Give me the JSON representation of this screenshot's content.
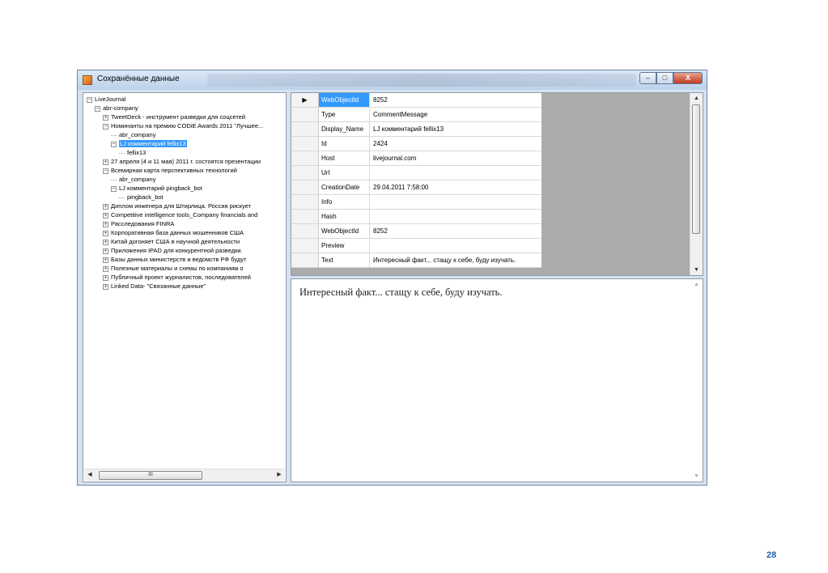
{
  "window": {
    "title": "Сохранённые данные",
    "controls": {
      "minimize": "–",
      "maximize": "□",
      "close": "X"
    }
  },
  "tree": {
    "items": [
      {
        "label": "LiveJournal",
        "level": 0,
        "toggle": "minus"
      },
      {
        "label": "abr-company",
        "level": 1,
        "toggle": "minus"
      },
      {
        "label": "TweetDeck - инструмент разведки для соцсетей",
        "level": 2,
        "toggle": "plus"
      },
      {
        "label": "Номинанты на премию CODiE Awards 2011 \"Лучшее...",
        "level": 2,
        "toggle": "minus"
      },
      {
        "label": "abr_company",
        "level": 3,
        "toggle": "leaf"
      },
      {
        "label": "LJ комментарий fellix13",
        "level": 3,
        "toggle": "minus",
        "selected": true
      },
      {
        "label": "fellix13",
        "level": 4,
        "toggle": "leaf"
      },
      {
        "label": "27 апреля (4 и 11 мая) 2011 г. состоятся презентации",
        "level": 2,
        "toggle": "plus"
      },
      {
        "label": "Всемирная карта перспективных технологий",
        "level": 2,
        "toggle": "minus"
      },
      {
        "label": "abr_company",
        "level": 3,
        "toggle": "leaf"
      },
      {
        "label": "LJ комментарий pingback_bot",
        "level": 3,
        "toggle": "minus"
      },
      {
        "label": "pingback_bot",
        "level": 4,
        "toggle": "leaf"
      },
      {
        "label": "Диплом инженера для Штирлица. Россия рискует",
        "level": 2,
        "toggle": "plus"
      },
      {
        "label": "Competitive intelligence tools_Company financials and",
        "level": 2,
        "toggle": "plus"
      },
      {
        "label": "Расследования FINRA",
        "level": 2,
        "toggle": "plus"
      },
      {
        "label": "Корпоративная база данных мошенников США",
        "level": 2,
        "toggle": "plus"
      },
      {
        "label": "Китай догоняет США в научной деятельности",
        "level": 2,
        "toggle": "plus"
      },
      {
        "label": "Приложения IPAD для конкурентной разведки.",
        "level": 2,
        "toggle": "plus"
      },
      {
        "label": "Базы данных министерств и ведомств РФ будут",
        "level": 2,
        "toggle": "plus"
      },
      {
        "label": "Полезные материалы и схемы по компаниям о",
        "level": 2,
        "toggle": "plus"
      },
      {
        "label": "Публичный проект журналистов, последователей",
        "level": 2,
        "toggle": "plus"
      },
      {
        "label": "Linked Data- \"Связанные данные\"",
        "level": 2,
        "toggle": "plus"
      }
    ],
    "scroll_thumb_label": "III",
    "scroll_left": "◀",
    "scroll_right": "▶"
  },
  "grid": {
    "row_header_marker": "▶",
    "rows": [
      {
        "key": "WebObjectId",
        "value": "8252",
        "active": true
      },
      {
        "key": "Type",
        "value": "CommentMessage"
      },
      {
        "key": "Display_Name",
        "value": "LJ комментарий fellix13"
      },
      {
        "key": "Id",
        "value": "2424"
      },
      {
        "key": "Host",
        "value": "livejournal.com"
      },
      {
        "key": "Url",
        "value": ""
      },
      {
        "key": "CreationDate",
        "value": "29.04.2011 7:58:00"
      },
      {
        "key": "Info",
        "value": ""
      },
      {
        "key": "Hash",
        "value": ""
      },
      {
        "key": "WebObjectId",
        "value": "8252"
      },
      {
        "key": "Preview",
        "value": ""
      },
      {
        "key": "Text",
        "value": "Интересный факт... стащу к себе, буду изучать."
      }
    ],
    "scroll_up": "▲",
    "scroll_down": "▼"
  },
  "text_panel": {
    "content": "Интересный факт... стащу к себе, буду изучать.",
    "scroll_up": "▲",
    "scroll_down": "▼"
  },
  "page_number": "28"
}
